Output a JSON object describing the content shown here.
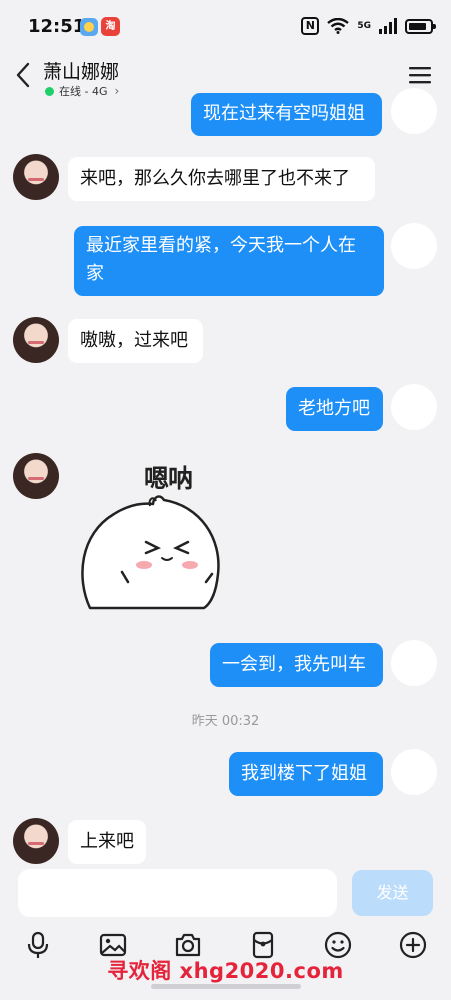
{
  "status_bar": {
    "time": "12:51",
    "app_badge": "淘",
    "network": "5G"
  },
  "header": {
    "title": "萧山娜娜",
    "presence": "在线 - 4G",
    "online_color": "#1fcf6b"
  },
  "messages": [
    {
      "direction": "out",
      "text": "现在过来有空吗姐姐"
    },
    {
      "direction": "in",
      "text": "来吧，那么久你去哪里了也不来了"
    },
    {
      "direction": "out",
      "text_lines": [
        "最近家里看的紧，今天我一个人在",
        "家"
      ]
    },
    {
      "direction": "in",
      "text": "嗷嗷，过来吧"
    },
    {
      "direction": "out",
      "text": "老地方吧"
    },
    {
      "direction": "in",
      "type": "sticker",
      "caption": "嗯呐",
      "icon": "blob-smile-sticker"
    },
    {
      "direction": "out",
      "text": "一会到，我先叫车"
    },
    {
      "type": "timestamp",
      "text": "昨天 00:32"
    },
    {
      "direction": "out",
      "text": "我到楼下了姐姐"
    },
    {
      "direction": "in",
      "text": "上来吧"
    }
  ],
  "composer": {
    "value": "",
    "placeholder": "",
    "send_label": "发送"
  },
  "toolbar": {
    "icons": [
      "microphone-icon",
      "image-icon",
      "camera-icon",
      "red-packet-icon",
      "emoji-icon",
      "plus-icon"
    ]
  },
  "watermark": "寻欢阁 xhg2020.com",
  "colors": {
    "accent": "#1e8ff7",
    "background": "#f2f2f4",
    "send_disabled": "#bcdcfb",
    "watermark": "#e5243b"
  }
}
